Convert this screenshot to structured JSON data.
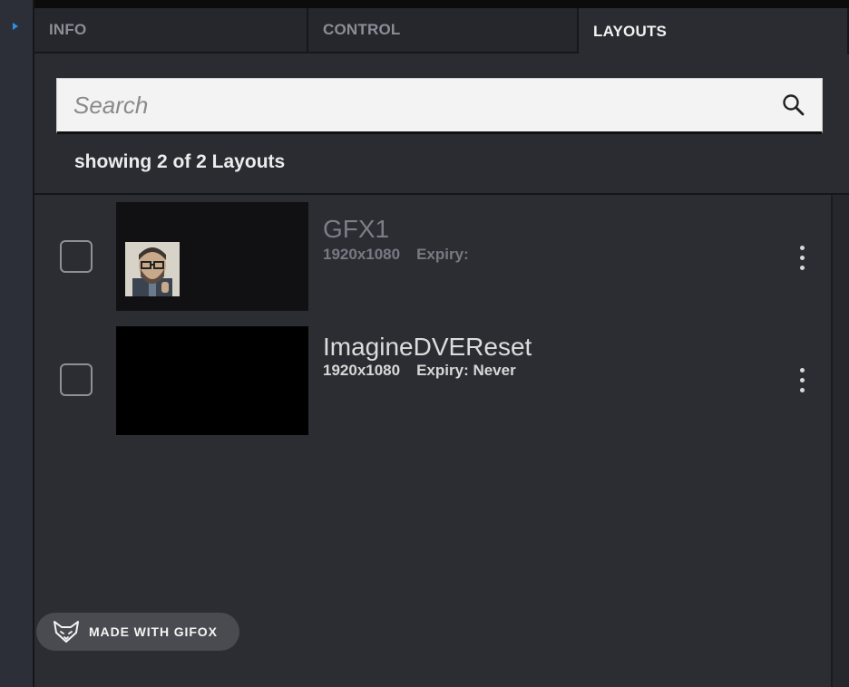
{
  "tabs": [
    {
      "label": "INFO",
      "active": false
    },
    {
      "label": "CONTROL",
      "active": false
    },
    {
      "label": "LAYOUTS",
      "active": true
    }
  ],
  "search": {
    "placeholder": "Search",
    "value": ""
  },
  "layout_count": "showing 2 of 2 Layouts",
  "layouts": [
    {
      "name": "GFX1",
      "resolution": "1920x1080",
      "expiry": "Expiry:",
      "checked": false
    },
    {
      "name": "ImagineDVEReset",
      "resolution": "1920x1080",
      "expiry": "Expiry: Never",
      "checked": false
    }
  ],
  "watermark": {
    "text": "MADE WITH GIFOX"
  },
  "colors": {
    "accent": "#2b8fe6",
    "background": "#2a2c31",
    "active_tab": "#2a2c31"
  }
}
